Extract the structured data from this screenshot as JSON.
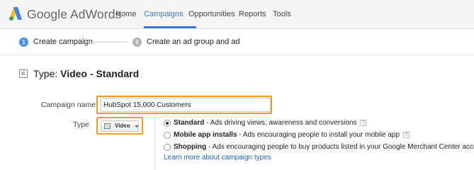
{
  "header": {
    "brand": "Google AdWords",
    "nav": [
      {
        "label": "Home"
      },
      {
        "label": "Campaigns"
      },
      {
        "label": "Opportunities"
      },
      {
        "label": "Reports"
      },
      {
        "label": "Tools"
      }
    ],
    "active_nav": "Campaigns",
    "accent_color": "#3a78d8"
  },
  "stepper": {
    "steps": [
      {
        "number": "1",
        "label": "Create campaign",
        "state": "active"
      },
      {
        "number": "2",
        "label": "Create an ad group and ad",
        "state": "inactive"
      }
    ]
  },
  "type_heading": {
    "prefix": "Type:",
    "value": "Video - Standard"
  },
  "form": {
    "campaign_name_label": "Campaign name",
    "campaign_name_value": "HubSpot 15,000 Customers",
    "type_label": "Type",
    "type_selected": "Video",
    "highlight_color": "#f39b1a",
    "options": [
      {
        "title": "Standard",
        "description": " - Ads driving views, awareness and conversions",
        "checked": true,
        "help": "?"
      },
      {
        "title": "Mobile app installs",
        "description": " - Ads encouraging people to install your mobile app",
        "checked": false,
        "help": "?"
      },
      {
        "title": "Shopping",
        "description": " - Ads encouraging people to buy products listed in your Google Merchant Center account",
        "checked": false,
        "help": "?"
      }
    ],
    "learn_more": "Learn more about campaign types"
  }
}
